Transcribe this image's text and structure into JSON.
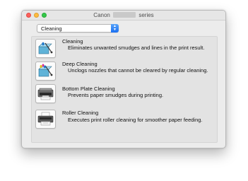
{
  "window": {
    "title_prefix": "Canon",
    "title_suffix": "series"
  },
  "dropdown": {
    "selected": "Cleaning"
  },
  "items": [
    {
      "name": "Cleaning",
      "description": "Eliminates unwanted smudges and lines in the print result.",
      "icon": "cleaning-icon"
    },
    {
      "name": "Deep Cleaning",
      "description": "Unclogs nozzles that cannot be cleared by regular cleaning.",
      "icon": "deep-cleaning-icon"
    },
    {
      "name": "Bottom Plate Cleaning",
      "description": "Prevents paper smudges during printing.",
      "icon": "bottom-plate-cleaning-icon"
    },
    {
      "name": "Roller Cleaning",
      "description": "Executes print roller cleaning for smoother paper feeding.",
      "icon": "roller-cleaning-icon"
    }
  ]
}
